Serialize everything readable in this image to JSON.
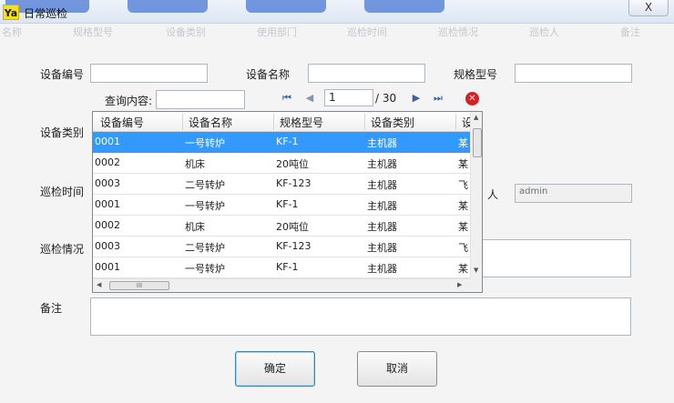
{
  "window": {
    "icon_text": "Ya",
    "title": "日常巡检",
    "close_symbol": "X"
  },
  "ghost_headers": [
    "名称",
    "规格型号",
    "设备类别",
    "使用部门",
    "巡检时间",
    "巡检情况",
    "巡检人",
    "备注"
  ],
  "form": {
    "device_code_label": "设备编号",
    "device_name_label": "设备名称",
    "spec_label": "规格型号",
    "query_label": "查询内容:",
    "device_type_label": "设备类别",
    "inspect_time_label": "巡检时间",
    "inspector_label": "人",
    "inspector_value": "admin",
    "inspect_status_label": "巡检情况",
    "remark_label": "备注"
  },
  "pager": {
    "first_icon": "⏮",
    "prev_icon": "◀",
    "page_value": "1",
    "total": "/ 30",
    "next_icon": "▶",
    "last_icon": "⏭",
    "close_icon_text": "✕"
  },
  "grid": {
    "columns": [
      "设备编号",
      "设备名称",
      "规格型号",
      "设备类别",
      "设"
    ],
    "rows": [
      {
        "code": "0001",
        "name": "一号转炉",
        "spec": "KF-1",
        "type": "主机器",
        "extra": "某"
      },
      {
        "code": "0002",
        "name": "机床",
        "spec": "20吨位",
        "type": "主机器",
        "extra": "某"
      },
      {
        "code": "0003",
        "name": "二号转炉",
        "spec": "KF-123",
        "type": "主机器",
        "extra": "飞"
      },
      {
        "code": "0001",
        "name": "一号转炉",
        "spec": "KF-1",
        "type": "主机器",
        "extra": "某"
      },
      {
        "code": "0002",
        "name": "机床",
        "spec": "20吨位",
        "type": "主机器",
        "extra": "某"
      },
      {
        "code": "0003",
        "name": "二号转炉",
        "spec": "KF-123",
        "type": "主机器",
        "extra": "飞"
      },
      {
        "code": "0001",
        "name": "一号转炉",
        "spec": "KF-1",
        "type": "主机器",
        "extra": "某"
      }
    ],
    "selected_row": 0,
    "hscroll_thumb_text": "III"
  },
  "buttons": {
    "ok": "确定",
    "cancel": "取消"
  },
  "colors": {
    "selection": "#3399ff",
    "title_bar": "#dce6f2",
    "error_red": "#d42222"
  }
}
